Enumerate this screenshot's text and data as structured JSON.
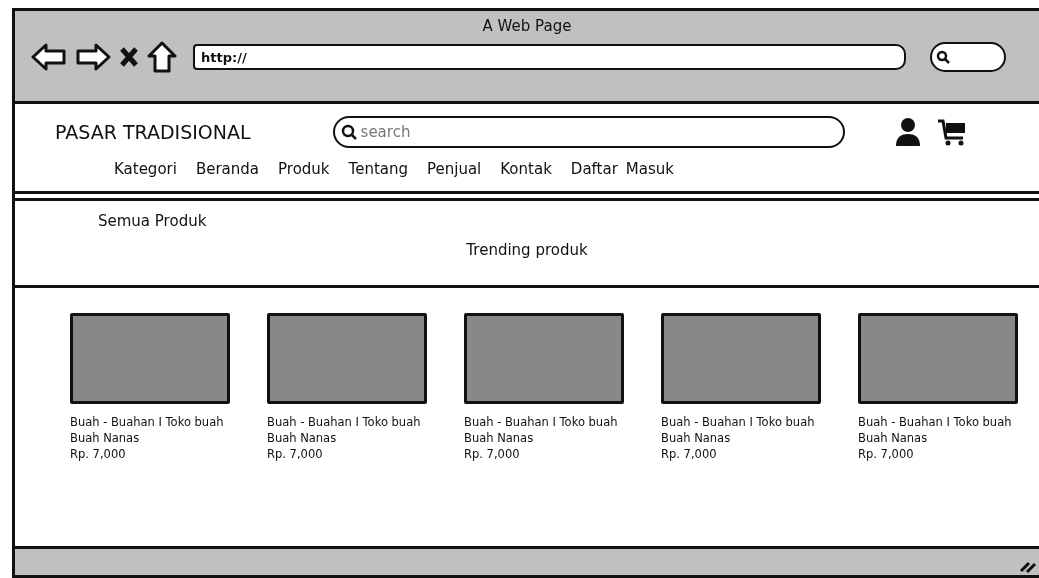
{
  "window": {
    "title": "A Web Page",
    "url": "http://"
  },
  "header": {
    "logo": "PASAR TRADISIONAL",
    "search": {
      "placeholder": "search"
    },
    "nav": [
      "Kategori",
      "Beranda",
      "Produk",
      "Tentang",
      "Penjual",
      "Kontak",
      "Daftar",
      "Masuk"
    ]
  },
  "section": {
    "link": "Semua Produk",
    "heading": "Trending produk"
  },
  "products": [
    {
      "title": "Buah - Buahan I Toko buah",
      "name": "Buah Nanas",
      "price": "Rp. 7,000"
    },
    {
      "title": "Buah - Buahan I Toko buah",
      "name": "Buah Nanas",
      "price": "Rp. 7,000"
    },
    {
      "title": "Buah - Buahan I Toko buah",
      "name": "Buah Nanas",
      "price": "Rp. 7,000"
    },
    {
      "title": "Buah - Buahan I Toko buah",
      "name": "Buah Nanas",
      "price": "Rp. 7,000"
    },
    {
      "title": "Buah - Buahan I Toko buah",
      "name": "Buah Nanas",
      "price": "Rp. 7,000"
    }
  ]
}
